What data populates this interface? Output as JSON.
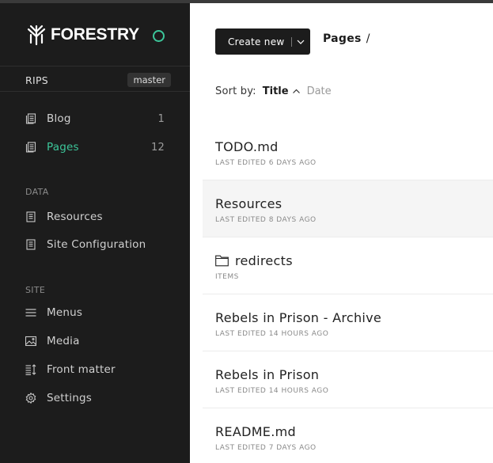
{
  "brand": {
    "name": "FORESTRY",
    "accent": "#3cc69a"
  },
  "site": {
    "name": "RIPS",
    "branch": "master"
  },
  "sidebar": {
    "collections": [
      {
        "label": "Blog",
        "count": "1",
        "icon": "document-stack-icon"
      },
      {
        "label": "Pages",
        "count": "12",
        "icon": "document-stack-icon",
        "active": true
      }
    ],
    "data_heading": "DATA",
    "data_items": [
      {
        "label": "Resources",
        "icon": "document-icon"
      },
      {
        "label": "Site Configuration",
        "icon": "document-icon"
      }
    ],
    "site_heading": "SITE",
    "site_items": [
      {
        "label": "Menus",
        "icon": "menu-icon"
      },
      {
        "label": "Media",
        "icon": "image-icon"
      },
      {
        "label": "Front matter",
        "icon": "front-matter-icon"
      },
      {
        "label": "Settings",
        "icon": "gear-icon"
      }
    ]
  },
  "toolbar": {
    "create_label": "Create new"
  },
  "breadcrumb": {
    "current": "Pages",
    "separator": "/"
  },
  "sort": {
    "label": "Sort by:",
    "active": "Title",
    "other": "Date"
  },
  "list": [
    {
      "title": "TODO.md",
      "meta": "LAST EDITED 6 DAYS AGO"
    },
    {
      "title": "Resources",
      "meta": "LAST EDITED 8 DAYS AGO"
    },
    {
      "title": "redirects",
      "meta": "ITEMS"
    },
    {
      "title": "Rebels in Prison - Archive",
      "meta": "LAST EDITED 14 HOURS AGO"
    },
    {
      "title": "Rebels in Prison",
      "meta": "LAST EDITED 14 HOURS AGO"
    },
    {
      "title": "README.md",
      "meta": "LAST EDITED 7 DAYS AGO"
    }
  ]
}
